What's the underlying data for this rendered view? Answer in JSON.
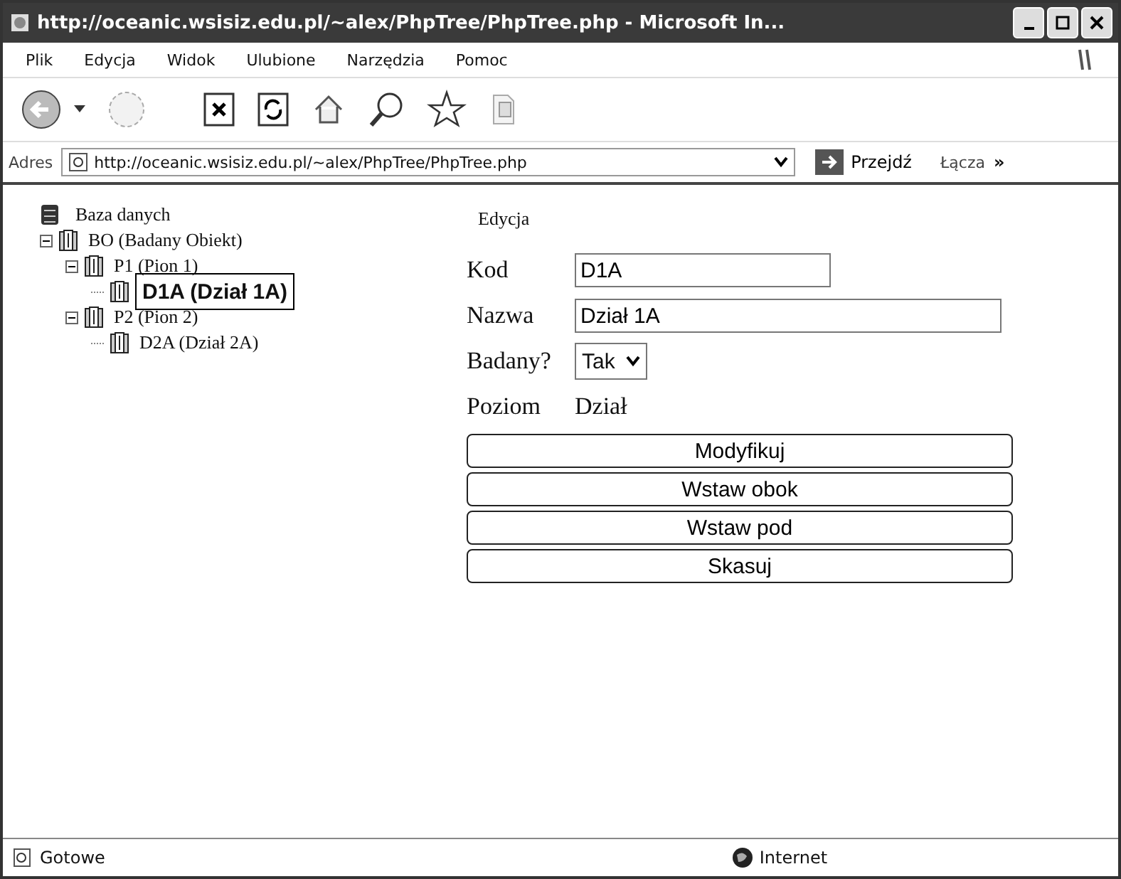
{
  "window": {
    "title": "http://oceanic.wsisiz.edu.pl/~alex/PhpTree/PhpTree.php - Microsoft In..."
  },
  "menu": [
    "Plik",
    "Edycja",
    "Widok",
    "Ulubione",
    "Narzędzia",
    "Pomoc"
  ],
  "address_bar": {
    "label": "Adres",
    "value": "http://oceanic.wsisiz.edu.pl/~alex/PhpTree/PhpTree.php",
    "go": "Przejdź",
    "links": "Łącza",
    "more": "»"
  },
  "tree": {
    "root": "Baza danych",
    "children": [
      {
        "label": "BO (Badany Obiekt)",
        "expanded": true,
        "selected": false,
        "children": [
          {
            "label": "P1 (Pion 1)",
            "expanded": true,
            "selected": false,
            "children": [
              {
                "label": "D1A (Dział 1A)",
                "selected": true
              }
            ]
          },
          {
            "label": "P2 (Pion 2)",
            "expanded": true,
            "selected": false,
            "children": [
              {
                "label": "D2A (Dział 2A)",
                "selected": false
              }
            ]
          }
        ]
      }
    ]
  },
  "form": {
    "heading": "Edycja",
    "fields": [
      {
        "kind": "text",
        "label": "Kod",
        "value": "D1A",
        "wide": false
      },
      {
        "kind": "text",
        "label": "Nazwa",
        "value": "Dział 1A",
        "wide": true
      },
      {
        "kind": "select",
        "label": "Badany?",
        "value": "Tak"
      },
      {
        "kind": "static",
        "label": "Poziom",
        "value": "Dział"
      }
    ],
    "buttons": [
      "Modyfikuj",
      "Wstaw obok",
      "Wstaw pod",
      "Skasuj"
    ]
  },
  "status_bar": {
    "text": "Gotowe",
    "zone": "Internet"
  }
}
